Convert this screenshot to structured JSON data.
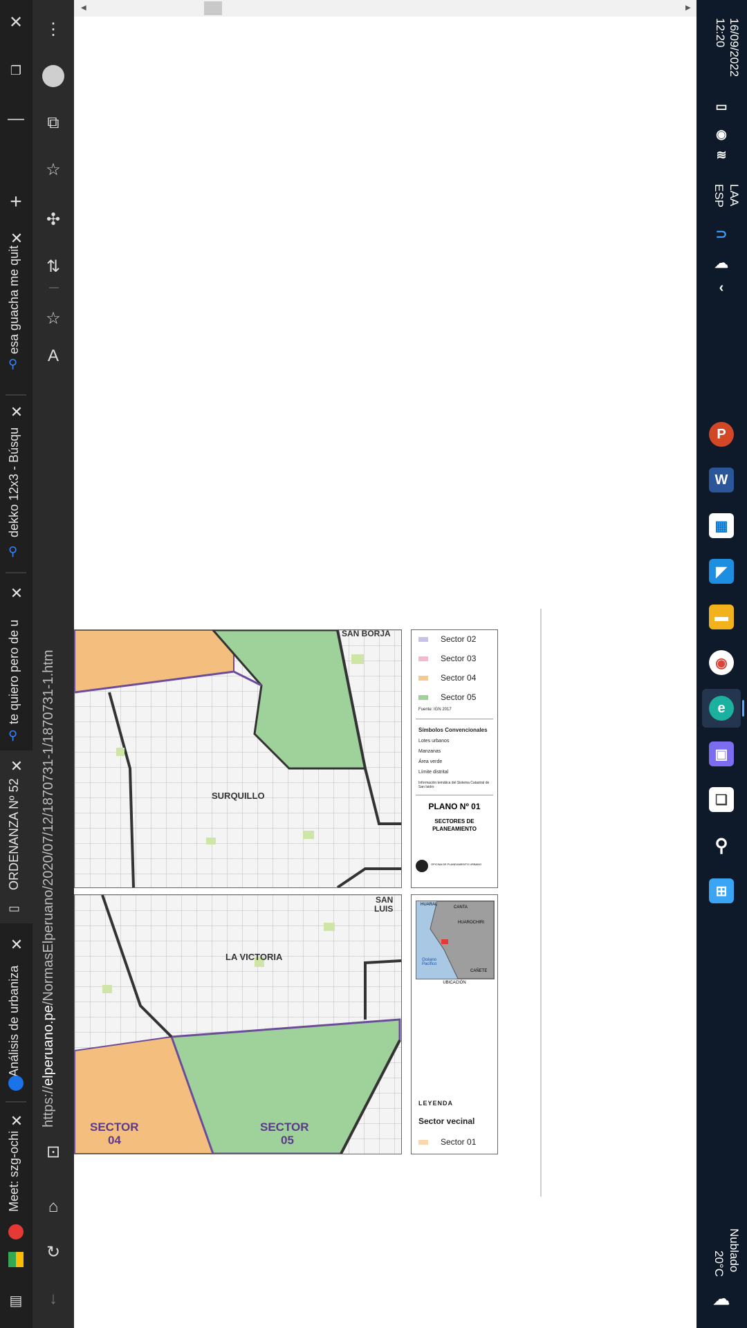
{
  "tabs": [
    {
      "title": "te quiero pero de u",
      "close": "✕"
    },
    {
      "title": "dekko 12x3 - Búsqu",
      "close": "✕"
    },
    {
      "title": "esa guacha me quit",
      "close": "✕"
    },
    {
      "title": "ORDENANZA Nº 52",
      "close": "✕"
    },
    {
      "title": "Análisis de urbaniza",
      "close": "✕"
    },
    {
      "title": "Meet: szg-ochi",
      "close": "✕"
    }
  ],
  "new_tab": "+",
  "address": {
    "prefix": "https://",
    "domain": "elperuano.pe",
    "path": "/NormasElperuano/2020/07/12/1870731-1/1870731-1.htm"
  },
  "taskbar": {
    "time": "12:20",
    "date": "16/09/2022",
    "lang1": "ESP",
    "lang2": "LAA",
    "weather_temp": "20°C",
    "weather_desc": "Nublado",
    "colors": {
      "background": "#0e1a2a"
    }
  },
  "map": {
    "upper_labels": {
      "district": "SURQUILLO",
      "neighbor": "SAN BORJA"
    },
    "lower_labels": {
      "district": "LA VICTORIA",
      "neighbor1": "SAN",
      "neighbor2": "LUIS",
      "sector04a": "SECTOR",
      "sector04b": "04",
      "sector05a": "SECTOR",
      "sector05b": "05"
    },
    "legend_upper": {
      "sector02": "Sector 02",
      "sector03": "Sector 03",
      "sector04": "Sector 04",
      "sector05": "Sector 05",
      "fuente": "Fuente: IGN 2017",
      "simbolos": "Símbolos Convencionales",
      "lotes": "Lotes urbanos",
      "manzanas": "Manzanas",
      "area_verde": "Área verde",
      "limite": "Límite distrital",
      "info": "Información temática del Sistema Catastral de San Isidro",
      "plano": "PLANO Nº 01",
      "sectores1": "SECTORES DE",
      "sectores2": "PLANEAMIENTO",
      "oficina": "OFICINA DE PLANEAMIENTO URBANO"
    },
    "legend_lower": {
      "leyenda": "LEYENDA",
      "sector_vecinal": "Sector vecinal",
      "sector01": "Sector 01",
      "ubicacion": "UBICACIÓN",
      "huaral": "HUARAL",
      "canta": "CANTA",
      "huarochiri": "HUAROCHIRI",
      "canete": "CAÑETE",
      "oceano": "Océano Pacífico"
    },
    "colors": {
      "sector02": "#c7c3e6",
      "sector03": "#f5b8cf",
      "sector04": "#f7c98f",
      "sector05": "#9fd19a",
      "green": "#8cc98a",
      "orange": "#f4bf7e"
    }
  }
}
